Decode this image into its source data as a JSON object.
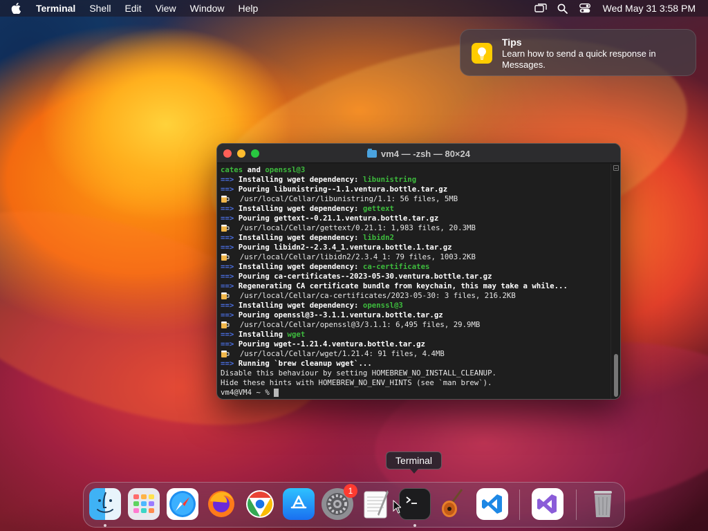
{
  "menubar": {
    "app_name": "Terminal",
    "items": [
      "Shell",
      "Edit",
      "View",
      "Window",
      "Help"
    ],
    "clock": "Wed May 31  3:58 PM"
  },
  "notification": {
    "title": "Tips",
    "body": "Learn how to send a quick response in Messages.",
    "icon": "lightbulb-icon"
  },
  "terminal": {
    "title": "vm4 — -zsh — 80×24",
    "lines": [
      {
        "segments": [
          {
            "t": "cates ",
            "c": "green"
          },
          {
            "t": "and ",
            "c": "bold"
          },
          {
            "t": "openssl@3",
            "c": "green"
          }
        ]
      },
      {
        "segments": [
          {
            "t": "==> ",
            "c": "arrow"
          },
          {
            "t": "Installing wget dependency: ",
            "c": "bold"
          },
          {
            "t": "libunistring",
            "c": "green"
          }
        ]
      },
      {
        "segments": [
          {
            "t": "==> ",
            "c": "arrow"
          },
          {
            "t": "Pouring libunistring--1.1.ventura.bottle.tar.gz",
            "c": "bold"
          }
        ]
      },
      {
        "beer": true,
        "segments": [
          {
            "t": "  /usr/local/Cellar/libunistring/1.1: 56 files, 5MB",
            "c": "plain"
          }
        ]
      },
      {
        "segments": [
          {
            "t": "==> ",
            "c": "arrow"
          },
          {
            "t": "Installing wget dependency: ",
            "c": "bold"
          },
          {
            "t": "gettext",
            "c": "green"
          }
        ]
      },
      {
        "segments": [
          {
            "t": "==> ",
            "c": "arrow"
          },
          {
            "t": "Pouring gettext--0.21.1.ventura.bottle.tar.gz",
            "c": "bold"
          }
        ]
      },
      {
        "beer": true,
        "segments": [
          {
            "t": "  /usr/local/Cellar/gettext/0.21.1: 1,983 files, 20.3MB",
            "c": "plain"
          }
        ]
      },
      {
        "segments": [
          {
            "t": "==> ",
            "c": "arrow"
          },
          {
            "t": "Installing wget dependency: ",
            "c": "bold"
          },
          {
            "t": "libidn2",
            "c": "green"
          }
        ]
      },
      {
        "segments": [
          {
            "t": "==> ",
            "c": "arrow"
          },
          {
            "t": "Pouring libidn2--2.3.4_1.ventura.bottle.1.tar.gz",
            "c": "bold"
          }
        ]
      },
      {
        "beer": true,
        "segments": [
          {
            "t": "  /usr/local/Cellar/libidn2/2.3.4_1: 79 files, 1003.2KB",
            "c": "plain"
          }
        ]
      },
      {
        "segments": [
          {
            "t": "==> ",
            "c": "arrow"
          },
          {
            "t": "Installing wget dependency: ",
            "c": "bold"
          },
          {
            "t": "ca-certificates",
            "c": "green"
          }
        ]
      },
      {
        "segments": [
          {
            "t": "==> ",
            "c": "arrow"
          },
          {
            "t": "Pouring ca-certificates--2023-05-30.ventura.bottle.tar.gz",
            "c": "bold"
          }
        ]
      },
      {
        "segments": [
          {
            "t": "==> ",
            "c": "arrow"
          },
          {
            "t": "Regenerating CA certificate bundle from keychain, this may take a while...",
            "c": "bold"
          }
        ]
      },
      {
        "beer": true,
        "segments": [
          {
            "t": "  /usr/local/Cellar/ca-certificates/2023-05-30: 3 files, 216.2KB",
            "c": "plain"
          }
        ]
      },
      {
        "segments": [
          {
            "t": "==> ",
            "c": "arrow"
          },
          {
            "t": "Installing wget dependency: ",
            "c": "bold"
          },
          {
            "t": "openssl@3",
            "c": "green"
          }
        ]
      },
      {
        "segments": [
          {
            "t": "==> ",
            "c": "arrow"
          },
          {
            "t": "Pouring openssl@3--3.1.1.ventura.bottle.tar.gz",
            "c": "bold"
          }
        ]
      },
      {
        "beer": true,
        "segments": [
          {
            "t": "  /usr/local/Cellar/openssl@3/3.1.1: 6,495 files, 29.9MB",
            "c": "plain"
          }
        ]
      },
      {
        "segments": [
          {
            "t": "==> ",
            "c": "arrow"
          },
          {
            "t": "Installing ",
            "c": "bold"
          },
          {
            "t": "wget",
            "c": "green"
          }
        ]
      },
      {
        "segments": [
          {
            "t": "==> ",
            "c": "arrow"
          },
          {
            "t": "Pouring wget--1.21.4.ventura.bottle.tar.gz",
            "c": "bold"
          }
        ]
      },
      {
        "beer": true,
        "segments": [
          {
            "t": "  /usr/local/Cellar/wget/1.21.4: 91 files, 4.4MB",
            "c": "plain"
          }
        ]
      },
      {
        "segments": [
          {
            "t": "==> ",
            "c": "arrow"
          },
          {
            "t": "Running `brew cleanup wget`...",
            "c": "bold"
          }
        ]
      },
      {
        "segments": [
          {
            "t": "Disable this behaviour by setting HOMEBREW_NO_INSTALL_CLEANUP.",
            "c": "plain"
          }
        ]
      },
      {
        "segments": [
          {
            "t": "Hide these hints with HOMEBREW_NO_ENV_HINTS (see `man brew`).",
            "c": "plain"
          }
        ]
      },
      {
        "cursor": true,
        "segments": [
          {
            "t": "vm4@VM4 ~ % ",
            "c": "plain"
          }
        ]
      }
    ]
  },
  "tooltip": {
    "label": "Terminal"
  },
  "dock": {
    "items": [
      {
        "name": "finder",
        "icon": "finder-icon",
        "running": true
      },
      {
        "name": "launchpad",
        "icon": "launchpad-icon"
      },
      {
        "name": "safari",
        "icon": "safari-icon"
      },
      {
        "name": "firefox",
        "icon": "firefox-icon"
      },
      {
        "name": "chrome",
        "icon": "chrome-icon"
      },
      {
        "name": "app-store",
        "icon": "app-store-icon"
      },
      {
        "name": "system-settings",
        "icon": "gear-icon",
        "badge": "1"
      },
      {
        "name": "textedit",
        "icon": "textedit-icon"
      },
      {
        "name": "terminal",
        "icon": "terminal-icon",
        "running": true
      },
      {
        "name": "garageband",
        "icon": "guitar-icon"
      },
      {
        "name": "vscode",
        "icon": "vscode-icon"
      },
      {
        "name": "visual-studio",
        "icon": "visual-studio-icon"
      },
      {
        "name": "trash",
        "icon": "trash-icon"
      }
    ]
  },
  "colors": {
    "terminal_arrow": "#4a6ee0",
    "terminal_green": "#3dbb3d",
    "close": "#ff5f57",
    "minimize": "#febc2e",
    "maximize": "#28c840",
    "notification_icon": "#ffcc00",
    "badge": "#ff3b30"
  }
}
